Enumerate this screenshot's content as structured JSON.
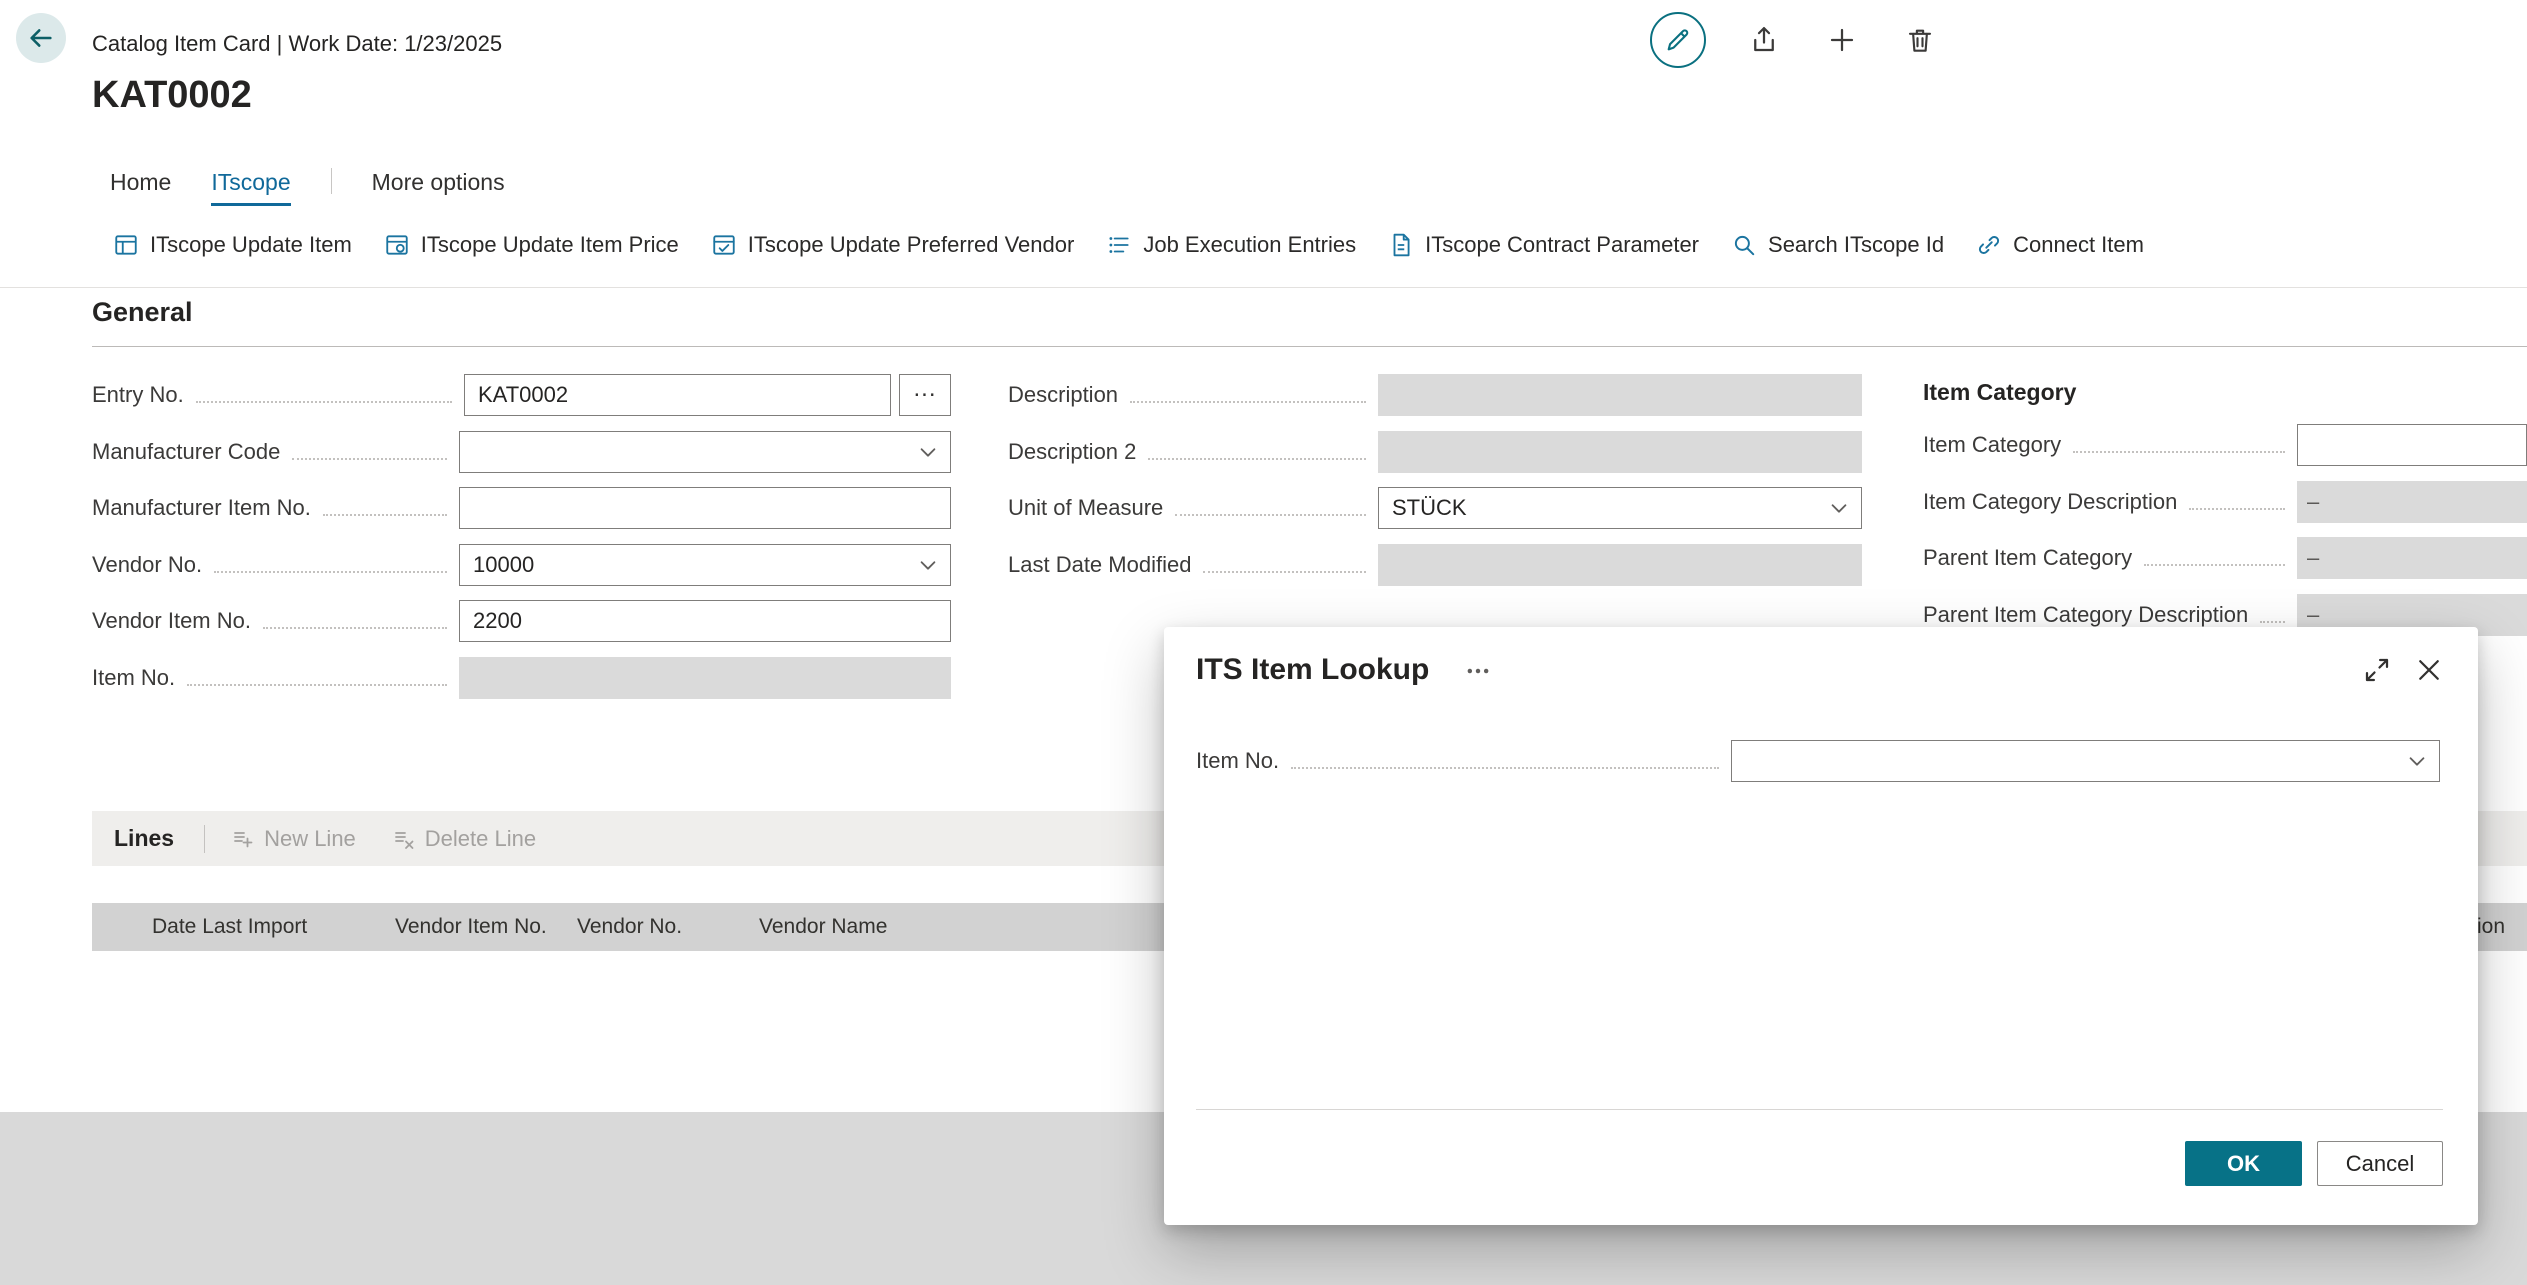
{
  "topbar": {
    "title": "Catalog Item Card | Work Date: 1/23/2025",
    "actions": [
      {
        "name": "edit",
        "icon": "pencil-icon"
      },
      {
        "name": "share",
        "icon": "share-icon"
      },
      {
        "name": "new",
        "icon": "plus-icon"
      },
      {
        "name": "delete",
        "icon": "trash-icon"
      }
    ]
  },
  "page": {
    "title": "KAT0002"
  },
  "tabs": {
    "items": [
      {
        "label": "Home",
        "selected": false
      },
      {
        "label": "ITscope",
        "selected": true
      },
      {
        "label": "More options",
        "selected": false
      }
    ]
  },
  "actionbar": {
    "items": [
      {
        "label": "ITscope Update Item",
        "icon": "update-item-icon"
      },
      {
        "label": "ITscope Update Item Price",
        "icon": "update-item-price-icon"
      },
      {
        "label": "ITscope Update Preferred Vendor",
        "icon": "update-preferred-vendor-icon"
      },
      {
        "label": "Job Execution Entries",
        "icon": "job-execution-entries-icon"
      },
      {
        "label": "ITscope Contract Parameter",
        "icon": "contract-parameter-icon"
      },
      {
        "label": "Search ITscope Id",
        "icon": "search-itscope-id-icon"
      },
      {
        "label": "Connect Item",
        "icon": "connect-item-icon"
      }
    ]
  },
  "general": {
    "section_title": "General",
    "fields": {
      "entry_no": {
        "label": "Entry No.",
        "value": "KAT0002",
        "assist": "..."
      },
      "manufacturer_code": {
        "label": "Manufacturer Code",
        "value": ""
      },
      "manufacturer_item_no": {
        "label": "Manufacturer Item No.",
        "value": ""
      },
      "vendor_no": {
        "label": "Vendor No.",
        "value": "10000"
      },
      "vendor_item_no": {
        "label": "Vendor Item No.",
        "value": "2200"
      },
      "item_no": {
        "label": "Item No.",
        "value": ""
      },
      "description": {
        "label": "Description",
        "value": ""
      },
      "description_2": {
        "label": "Description 2",
        "value": ""
      },
      "unit_of_measure": {
        "label": "Unit of Measure",
        "value": "STÜCK"
      },
      "last_date_modified": {
        "label": "Last Date Modified",
        "value": ""
      }
    }
  },
  "item_category": {
    "section_title": "Item Category",
    "fields": {
      "item_category": {
        "label": "Item Category",
        "value": ""
      },
      "item_category_description": {
        "label": "Item Category Description",
        "value": "–"
      },
      "parent_item_category": {
        "label": "Parent Item Category",
        "value": "–"
      },
      "parent_item_category_description": {
        "label": "Parent Item Category Description",
        "value": "–"
      }
    }
  },
  "lines": {
    "title": "Lines",
    "actions": [
      {
        "label": "New Line",
        "icon": "new-line-icon",
        "disabled": true
      },
      {
        "label": "Delete Line",
        "icon": "delete-line-icon",
        "disabled": true
      }
    ],
    "columns": [
      "Date Last Import",
      "Vendor Item No.",
      "Vendor No.",
      "Vendor Name",
      "Description"
    ],
    "rows": []
  },
  "dialog": {
    "title": "ITS Item Lookup",
    "fields": {
      "item_no": {
        "label": "Item No.",
        "value": ""
      }
    },
    "buttons": {
      "ok": "OK",
      "cancel": "Cancel"
    }
  },
  "colors": {
    "accent_icon": "#1b74a0",
    "primary_button": "#077287",
    "selected_tab": "#10699a",
    "disabled_field": "#dadada",
    "disabled_text": "#a3a19f"
  }
}
